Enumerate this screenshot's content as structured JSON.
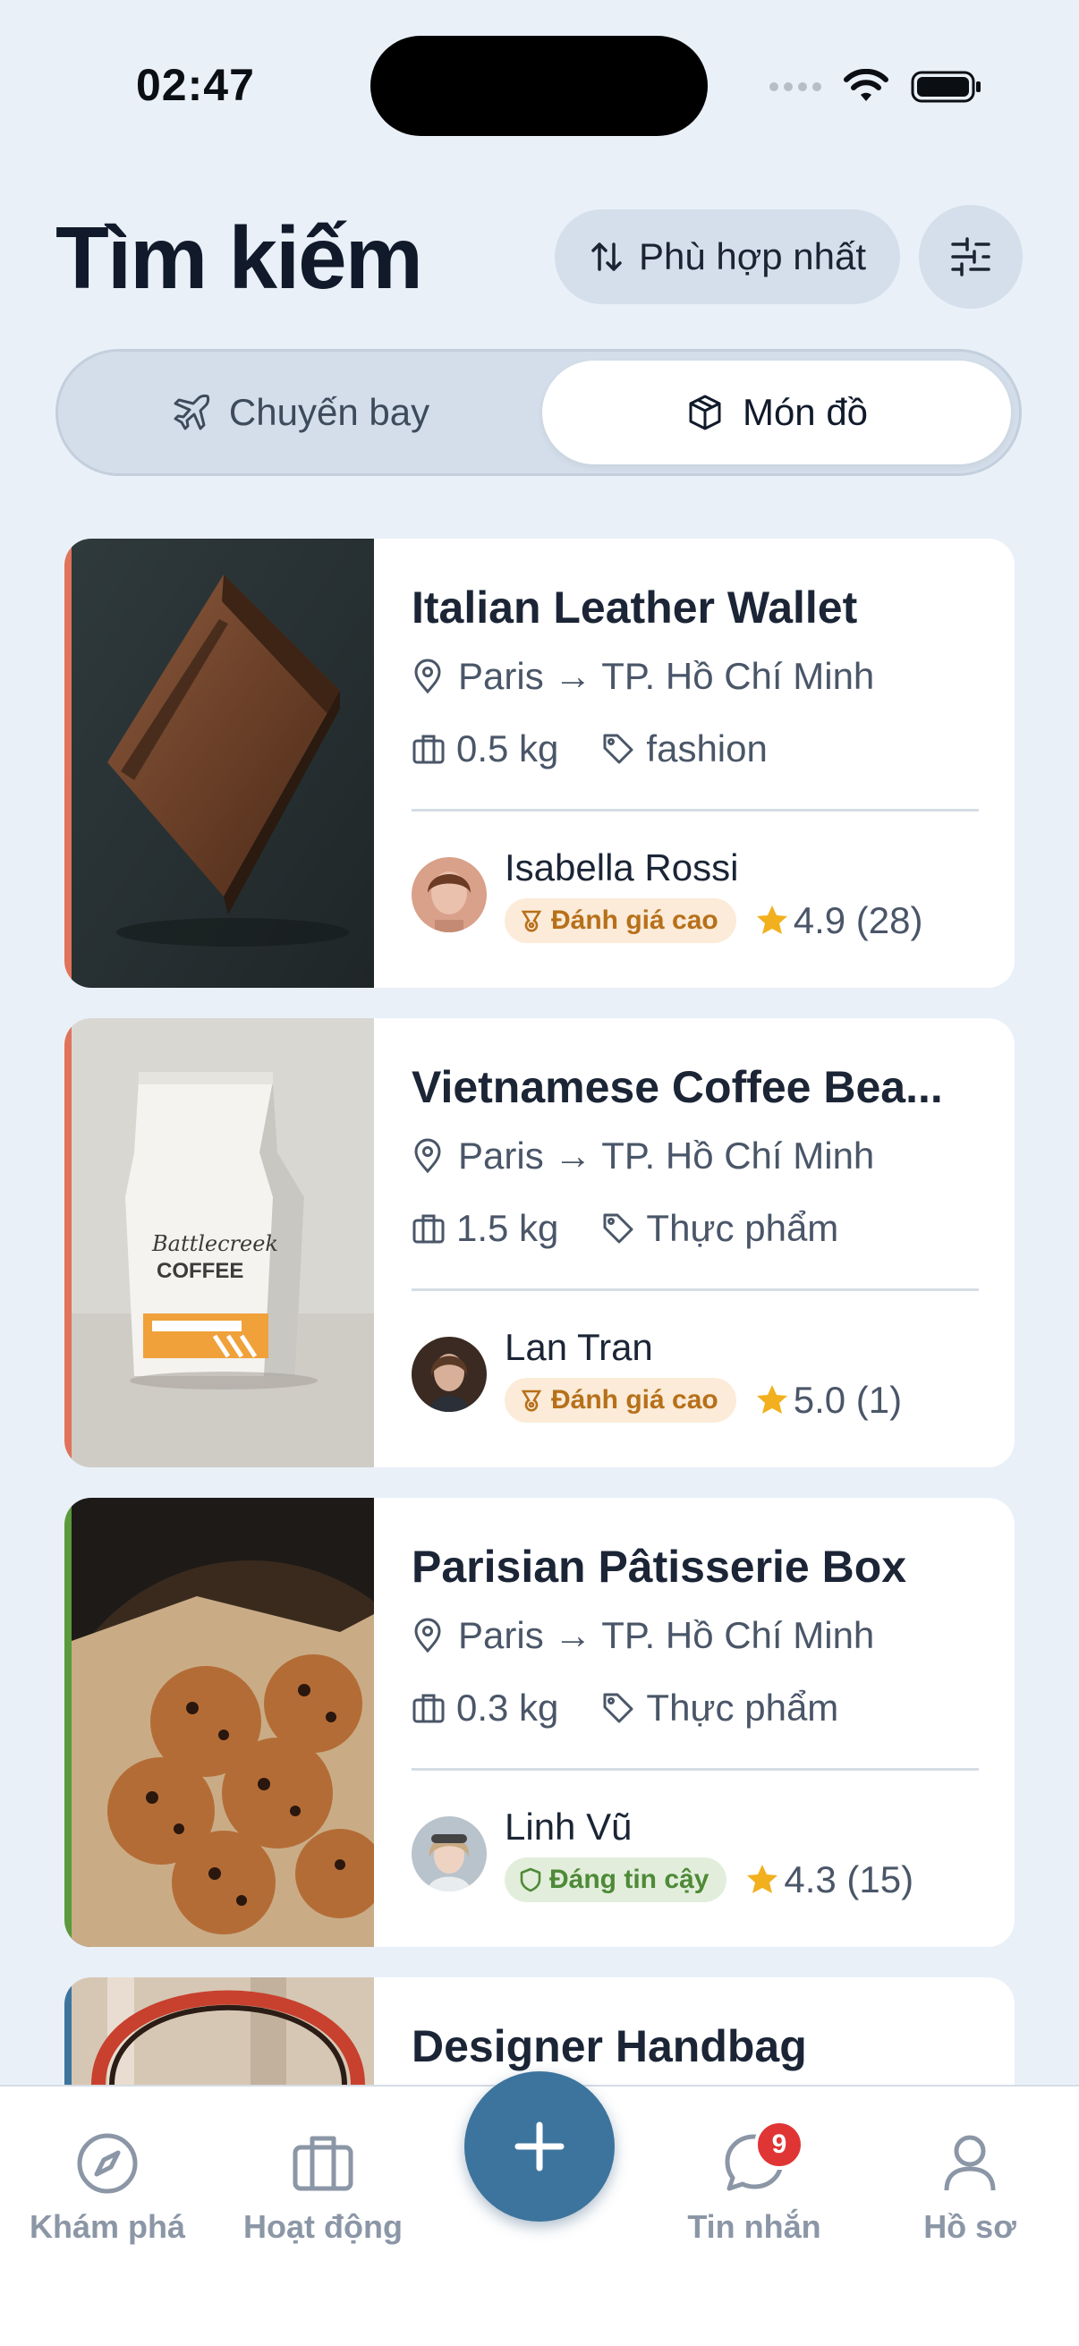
{
  "status": {
    "time": "02:47"
  },
  "header": {
    "title": "Tìm kiếm",
    "sort_label": "Phù hợp nhất"
  },
  "tabs": {
    "flights_label": "Chuyến bay",
    "items_label": "Món đồ"
  },
  "cards": [
    {
      "title": "Italian Leather Wallet",
      "route": "Paris → TP. Hồ Chí Minh",
      "weight": "0.5 kg",
      "category": "fashion",
      "seller": "Isabella Rossi",
      "badge": "Đánh giá cao",
      "rating": "4.9 (28)",
      "accent": "#e0735a"
    },
    {
      "title": "Vietnamese Coffee Bea...",
      "route": "Paris → TP. Hồ Chí Minh",
      "weight": "1.5 kg",
      "category": "Thực phẩm",
      "seller": "Lan Tran",
      "badge": "Đánh giá cao",
      "rating": "5.0 (1)",
      "accent": "#e0735a"
    },
    {
      "title": "Parisian Pâtisserie Box",
      "route": "Paris → TP. Hồ Chí Minh",
      "weight": "0.3 kg",
      "category": "Thực phẩm",
      "seller": "Linh Vũ",
      "badge": "Đáng tin cậy",
      "rating": "4.3 (15)",
      "accent": "#5a9a3c"
    },
    {
      "title": "Designer Handbag",
      "accent": "#3d749d"
    }
  ],
  "nav": {
    "explore": "Khám phá",
    "activity": "Hoạt động",
    "messages": "Tin nhắn",
    "messages_count": "9",
    "profile": "Hồ sơ"
  },
  "colors": {
    "primary": "#3d749d",
    "background": "#e9f0f8",
    "star": "#f2b01e"
  }
}
